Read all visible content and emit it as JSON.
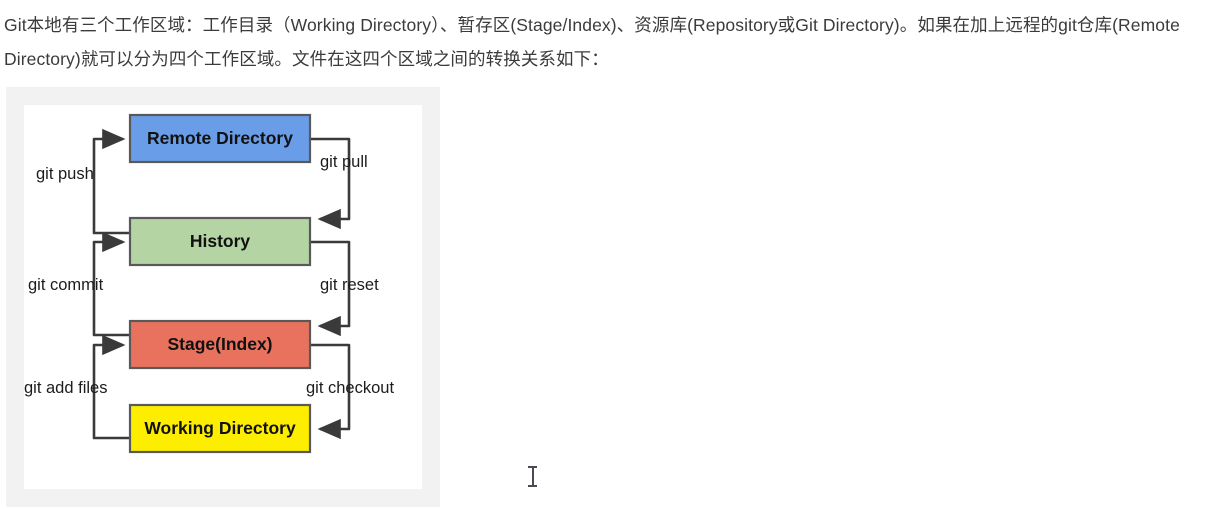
{
  "article": {
    "paragraph": "Git本地有三个工作区域：工作目录（Working Directory）、暂存区(Stage/Index)、资源库(Repository或Git Directory)。如果在加上远程的git仓库(Remote Directory)就可以分为四个工作区域。文件在这四个区域之间的转换关系如下："
  },
  "diagram": {
    "nodes": [
      {
        "id": "remote",
        "label": "Remote Directory",
        "color": "#6a9de8",
        "border": "#595959"
      },
      {
        "id": "history",
        "label": "History",
        "color": "#b4d4a4",
        "border": "#595959"
      },
      {
        "id": "stage",
        "label": "Stage(Index)",
        "color": "#e8725e",
        "border": "#595959"
      },
      {
        "id": "working",
        "label": "Working Directory",
        "color": "#fdee00",
        "border": "#595959"
      }
    ],
    "edges": [
      {
        "id": "push",
        "label": "git push",
        "from": "history",
        "to": "remote",
        "side": "left"
      },
      {
        "id": "pull",
        "label": "git pull",
        "from": "remote",
        "to": "history",
        "side": "right"
      },
      {
        "id": "commit",
        "label": "git commit",
        "from": "stage",
        "to": "history",
        "side": "left"
      },
      {
        "id": "reset",
        "label": "git reset",
        "from": "history",
        "to": "stage",
        "side": "right"
      },
      {
        "id": "add",
        "label": "git add files",
        "from": "working",
        "to": "stage",
        "side": "left"
      },
      {
        "id": "checkout",
        "label": "git checkout",
        "from": "stage",
        "to": "working",
        "side": "right"
      }
    ],
    "background": "#f2f2f2",
    "canvas": "#ffffff",
    "edge_color": "#3a3a3a"
  },
  "cursor": {
    "icon": "text-ibeam-cursor"
  }
}
